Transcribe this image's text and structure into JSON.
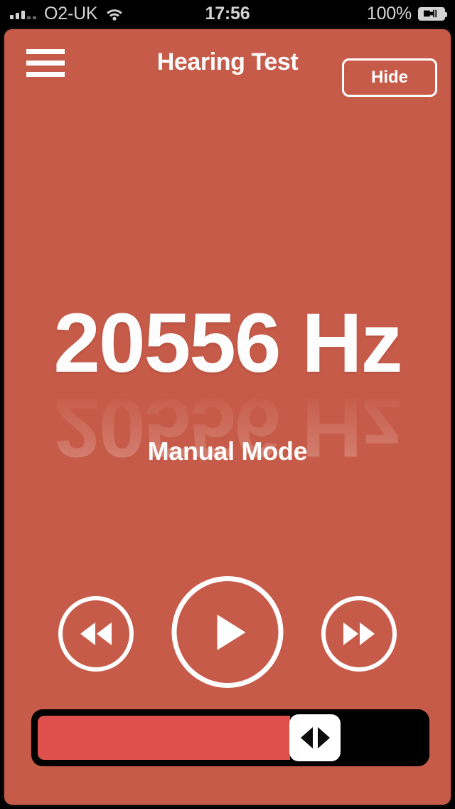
{
  "status_bar": {
    "carrier": "O2-UK",
    "signal_icon": "signal-bars-icon",
    "signal_bars_filled": 3,
    "signal_bars_total": 5,
    "wifi_icon": "wifi-icon",
    "time": "17:56",
    "battery_percent": "100%",
    "battery_icon": "battery-charging-icon"
  },
  "nav_bar": {
    "menu_icon": "hamburger-menu-icon",
    "title": "Hearing Test",
    "hide_label": "Hide"
  },
  "main": {
    "frequency_value": "20556 Hz",
    "mode_label": "Manual Mode"
  },
  "transport": {
    "rewind_icon": "rewind-icon",
    "play_icon": "play-icon",
    "forward_icon": "fast-forward-icon"
  },
  "slider": {
    "fill_percent": 65.5,
    "thumb_icon": "left-right-arrows-icon"
  },
  "colors": {
    "background": "#C75B49",
    "slider_fill": "#DF4F4B",
    "slider_track": "#000000",
    "foreground": "#FDFDFD",
    "status_bar_bg": "#000000",
    "status_bar_text": "#D3D3D3"
  }
}
